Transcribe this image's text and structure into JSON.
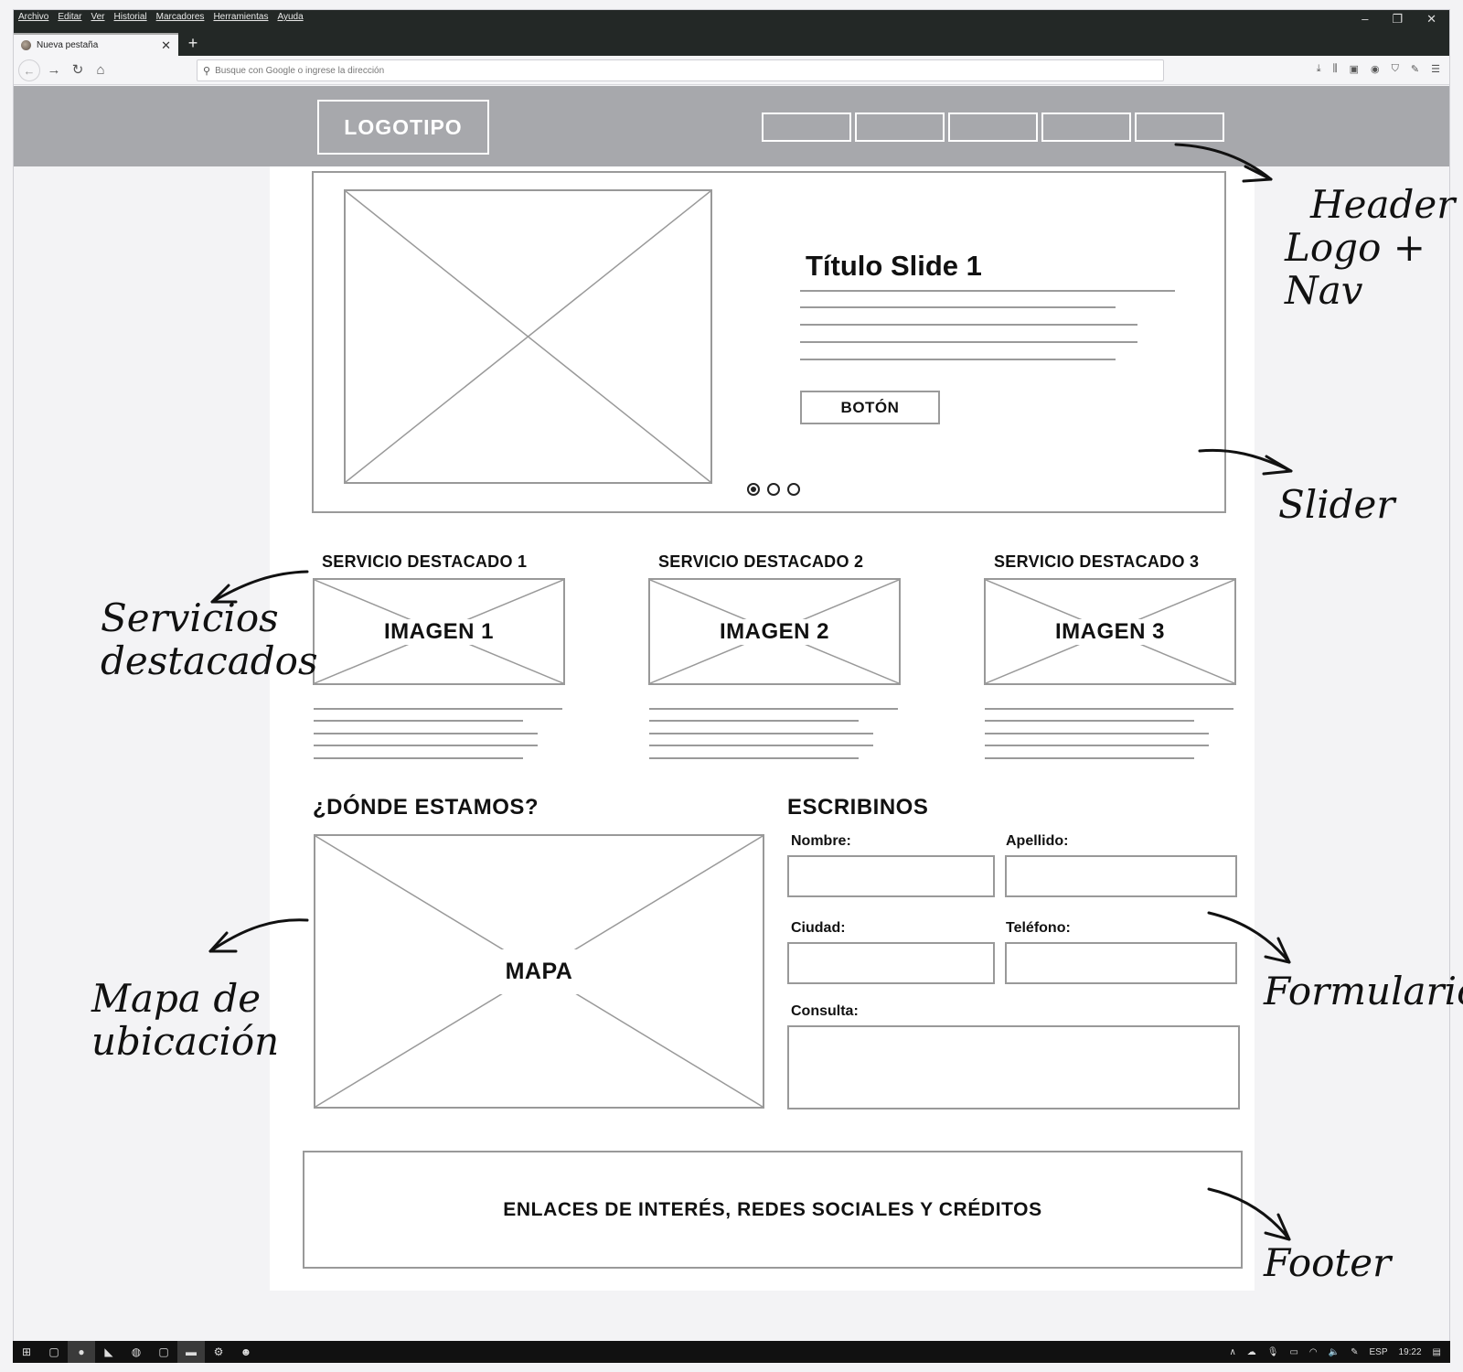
{
  "browser": {
    "menu": [
      "Archivo",
      "Editar",
      "Ver",
      "Historial",
      "Marcadores",
      "Herramientas",
      "Ayuda"
    ],
    "tab_title": "Nueva pestaña",
    "url_placeholder": "Busque con Google o ingrese la dirección"
  },
  "wireframe": {
    "logo": "LOGOTIPO",
    "slider": {
      "title": "Título Slide 1",
      "button": "BOTÓN",
      "dots": 3,
      "active_dot": 1
    },
    "services": [
      {
        "title": "SERVICIO DESTACADO 1",
        "image_label": "IMAGEN 1"
      },
      {
        "title": "SERVICIO DESTACADO 2",
        "image_label": "IMAGEN 2"
      },
      {
        "title": "SERVICIO DESTACADO 3",
        "image_label": "IMAGEN 3"
      }
    ],
    "location": {
      "title": "¿DÓNDE ESTAMOS?",
      "map_label": "MAPA"
    },
    "form": {
      "title": "ESCRIBINOS",
      "nombre": "Nombre:",
      "apellido": "Apellido:",
      "ciudad": "Ciudad:",
      "telefono": "Teléfono:",
      "consulta": "Consulta:"
    },
    "footer": "ENLACES DE INTERÉS, REDES SOCIALES Y CRÉDITOS"
  },
  "annotations": {
    "header_line1": "Header",
    "header_line2": "Logo + Nav",
    "slider": "Slider",
    "services_line1": "Servicios",
    "services_line2": "destacados",
    "map_line1": "Mapa de",
    "map_line2": "ubicación",
    "form": "Formulario",
    "footer": "Footer"
  },
  "taskbar": {
    "language": "ESP",
    "time": "19:22"
  }
}
